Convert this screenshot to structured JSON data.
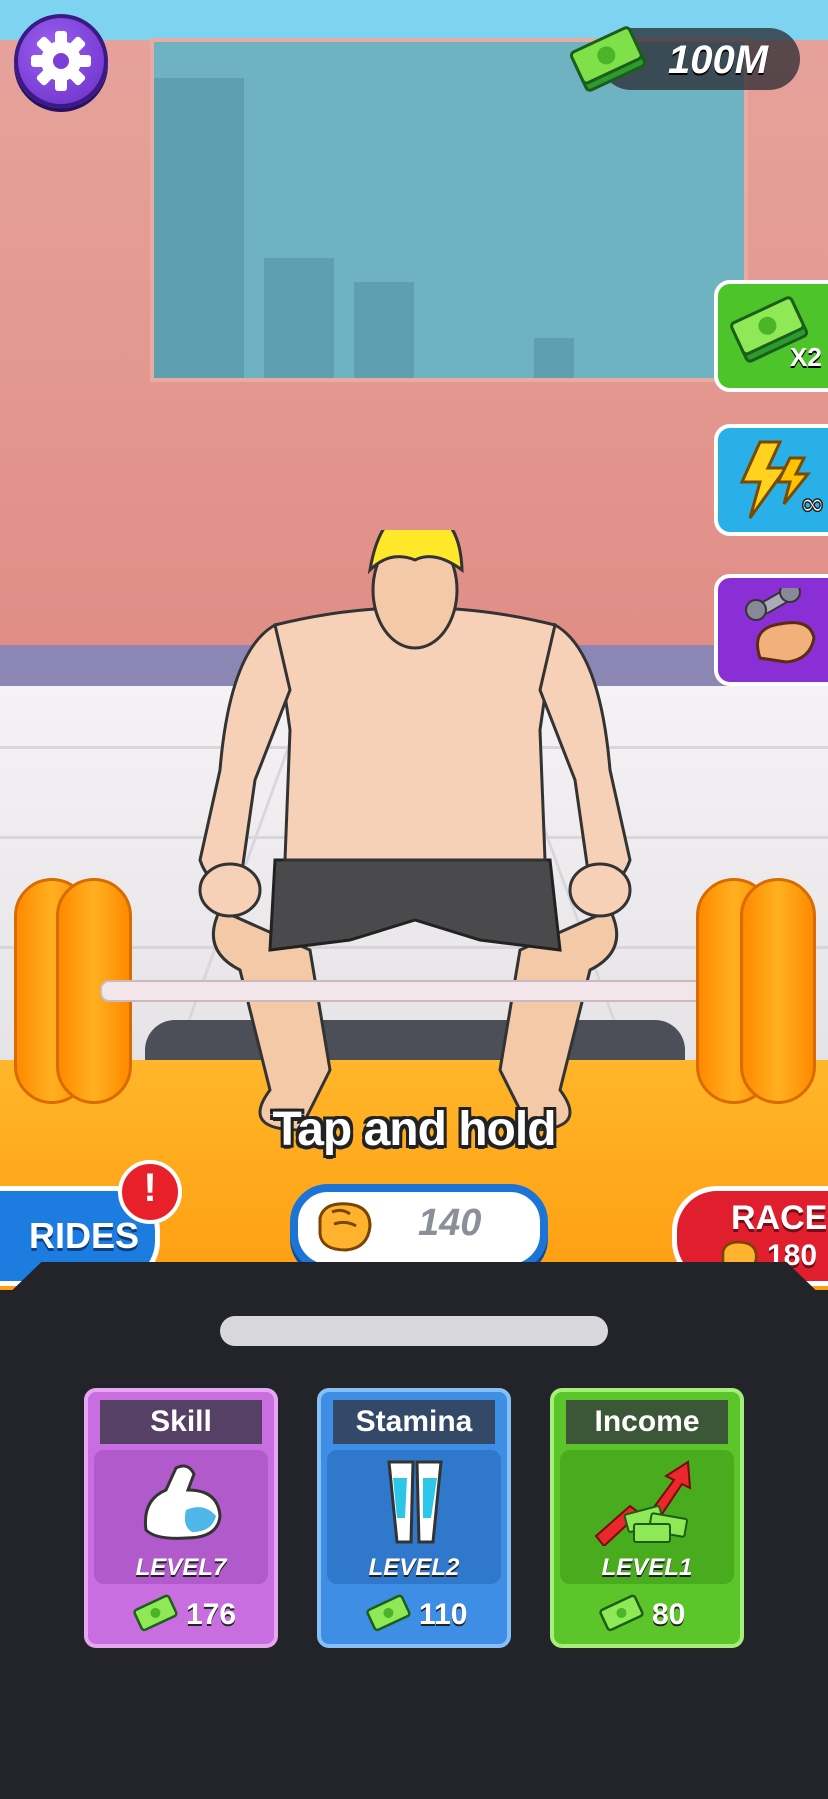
{
  "hud": {
    "money": "100M"
  },
  "side_buttons": [
    {
      "label": "X2",
      "icon": "cash-x2-icon"
    },
    {
      "icon": "lightning-infinity-icon"
    },
    {
      "icon": "dumbbell-arm-icon"
    }
  ],
  "prompt": "Tap and hold",
  "strength": {
    "value": "140"
  },
  "rides": {
    "label": "RIDES",
    "alert": "!"
  },
  "race": {
    "label": "RACE",
    "cost": "180"
  },
  "upgrades": [
    {
      "title": "Skill",
      "level": "LEVEL7",
      "cost": "176",
      "color": "#c86ee0"
    },
    {
      "title": "Stamina",
      "level": "LEVEL2",
      "cost": "110",
      "color": "#3e8ee6"
    },
    {
      "title": "Income",
      "level": "LEVEL1",
      "cost": "80",
      "color": "#5cc52a"
    }
  ]
}
